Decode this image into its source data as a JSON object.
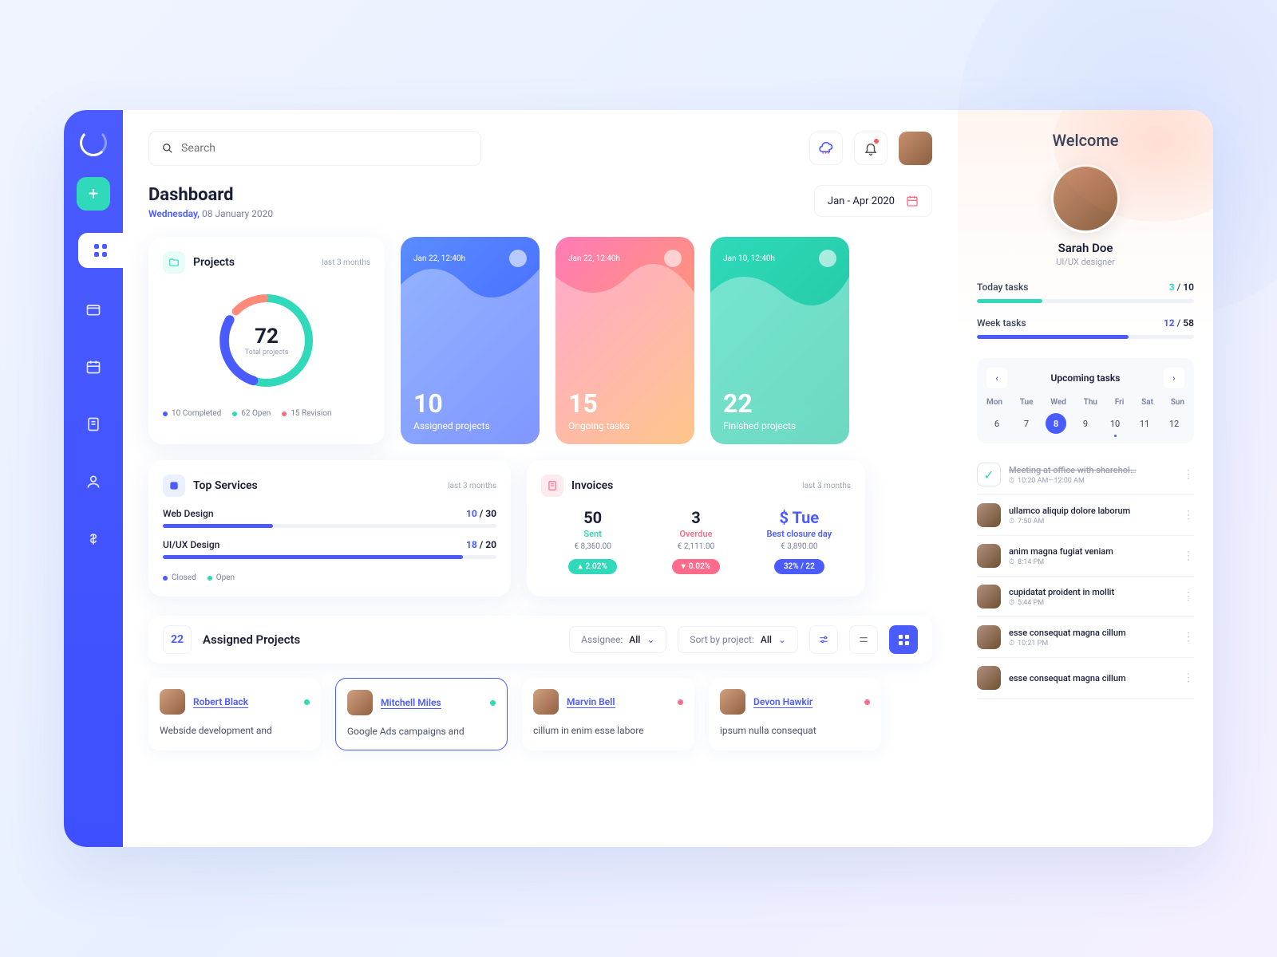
{
  "search": {
    "placeholder": "Search"
  },
  "header": {
    "title": "Dashboard",
    "day": "Wednesday,",
    "date": "08 January 2020",
    "range": "Jan - Apr 2020"
  },
  "projects": {
    "title": "Projects",
    "sub": "last 3 months",
    "total": "72",
    "total_label": "Total projects",
    "legend": [
      {
        "label": "10 Completed",
        "color": "#4A5CFF"
      },
      {
        "label": "62 Open",
        "color": "#2FD9B9"
      },
      {
        "label": "15 Revision",
        "color": "#FF6B8A"
      }
    ]
  },
  "stats": [
    {
      "date": "Jan 22, 12:40h",
      "num": "10",
      "label": "Assigned projects"
    },
    {
      "date": "Jan 22, 12:40h",
      "num": "15",
      "label": "Ongoing tasks"
    },
    {
      "date": "Jan 10, 12:40h",
      "num": "22",
      "label": "Finished projects"
    }
  ],
  "services": {
    "title": "Top Services",
    "sub": "last 3 months",
    "rows": [
      {
        "name": "Web Design",
        "done": "10",
        "total": "30"
      },
      {
        "name": "UI/UX Design",
        "done": "18",
        "total": "20"
      }
    ],
    "legend_closed": "Closed",
    "legend_open": "Open"
  },
  "invoices": {
    "title": "Invoices",
    "sub": "last 3 months",
    "cols": [
      {
        "num": "50",
        "label": "Sent",
        "label_color": "#2FD9B9",
        "amount": "€ 8,360.00",
        "badge": "2.02%",
        "badge_bg": "#2FD9B9",
        "arrow": "▴"
      },
      {
        "num": "3",
        "label": "Overdue",
        "label_color": "#FF6B8A",
        "amount": "€ 2,111.00",
        "badge": "0.02%",
        "badge_bg": "#FF6B8A",
        "arrow": "▾"
      },
      {
        "num": "$ Tue",
        "label": "Best closure day",
        "label_color": "#4A5CFF",
        "amount": "€ 3,890.00",
        "badge": "32% / 22",
        "badge_bg": "#4A5CFF",
        "arrow": ""
      }
    ]
  },
  "assigned": {
    "count": "22",
    "title": "Assigned Projects",
    "assignee_label": "Assignee:",
    "assignee_val": "All",
    "sort_label": "Sort by project:",
    "sort_val": "All",
    "cards": [
      {
        "name": "Robert Black",
        "desc": "Webside development and",
        "status": "#2FD9B9"
      },
      {
        "name": "Mitchell Miles",
        "desc": "Google Ads campaigns and",
        "status": "#2FD9B9"
      },
      {
        "name": "Marvin Bell",
        "desc": "cillum in enim esse labore",
        "status": "#FF6B8A"
      },
      {
        "name": "Devon Hawkir",
        "desc": "ipsum nulla consequat",
        "status": "#FF6B8A"
      }
    ]
  },
  "profile": {
    "welcome": "Welcome",
    "name": "Sarah Doe",
    "role": "UI/UX designer",
    "today_label": "Today tasks",
    "today_done": "3",
    "today_total": "10",
    "week_label": "Week tasks",
    "week_done": "12",
    "week_total": "58"
  },
  "calendar": {
    "title": "Upcoming tasks",
    "days": [
      "Mon",
      "Tue",
      "Wed",
      "Thu",
      "Fri",
      "Sat",
      "Sun"
    ],
    "dates": [
      "6",
      "7",
      "8",
      "9",
      "10",
      "11",
      "12"
    ]
  },
  "tasks": [
    {
      "title": "Meeting at office with sharehol…",
      "time": "10:20 AM—12:00 AM",
      "done": true
    },
    {
      "title": "ullamco aliquip dolore laborum",
      "time": "7:50 AM"
    },
    {
      "title": "anim magna fugiat veniam",
      "time": "8:14 PM"
    },
    {
      "title": "cupidatat proident in mollit",
      "time": "5:44 PM"
    },
    {
      "title": "esse consequat magna cillum",
      "time": "10:21 PM"
    },
    {
      "title": "esse consequat magna cillum",
      "time": ""
    }
  ],
  "chart_data": {
    "type": "pie",
    "title": "Projects",
    "series": [
      {
        "name": "Completed",
        "value": 10
      },
      {
        "name": "Open",
        "value": 62
      },
      {
        "name": "Revision",
        "value": 15
      }
    ]
  }
}
